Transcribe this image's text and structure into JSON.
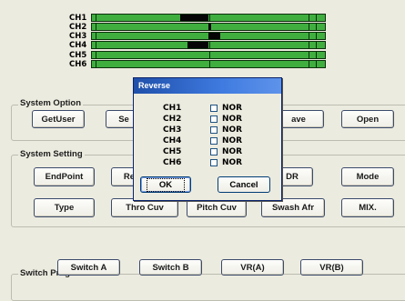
{
  "channels": [
    {
      "label": "CH1",
      "fill_from": 0.38,
      "fill_to": 0.5
    },
    {
      "label": "CH2",
      "fill_from": 0.5,
      "fill_to": 0.51
    },
    {
      "label": "CH3",
      "fill_from": 0.5,
      "fill_to": 0.55
    },
    {
      "label": "CH4",
      "fill_from": 0.41,
      "fill_to": 0.5
    },
    {
      "label": "CH5",
      "fill_from": 0.5,
      "fill_to": 0.5
    },
    {
      "label": "CH6",
      "fill_from": 0.5,
      "fill_to": 0.5
    }
  ],
  "system_option": {
    "title": "System Option",
    "buttons": [
      "GetUser",
      "Se",
      "ave",
      "Open"
    ]
  },
  "system_setting": {
    "title": "System Setting",
    "row1": [
      "EndPoint",
      "Re",
      "DR",
      "Mode"
    ],
    "row2": [
      "Type",
      "Thro Cuv",
      "Pitch Cuv",
      "Swash Afr",
      "MIX."
    ]
  },
  "switch_program": {
    "title": "Switch Program",
    "buttons": [
      "Switch A",
      "Switch B",
      "VR(A)",
      "VR(B)"
    ]
  },
  "dialog": {
    "title": "Reverse",
    "rows": [
      {
        "ch": "CH1",
        "value": "NOR",
        "checked": false
      },
      {
        "ch": "CH2",
        "value": "NOR",
        "checked": false
      },
      {
        "ch": "CH3",
        "value": "NOR",
        "checked": false
      },
      {
        "ch": "CH4",
        "value": "NOR",
        "checked": false
      },
      {
        "ch": "CH5",
        "value": "NOR",
        "checked": false
      },
      {
        "ch": "CH6",
        "value": "NOR",
        "checked": false
      }
    ],
    "ok": "OK",
    "cancel": "Cancel"
  },
  "colors": {
    "bar_green": "#3fae3f",
    "bar_fill": "#050505",
    "titlebar": "#2a5fc4",
    "background": "#ecebdf"
  }
}
